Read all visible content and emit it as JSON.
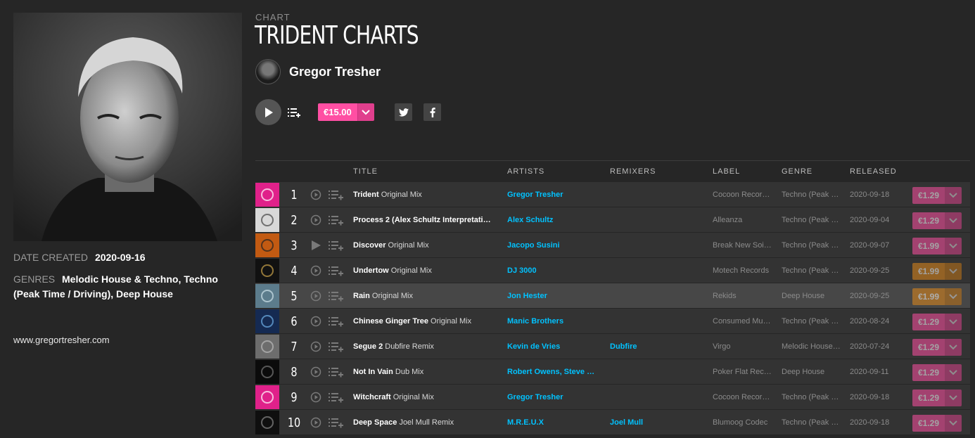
{
  "chart": {
    "eyebrow": "CHART",
    "title": "TRIDENT CHARTS",
    "curator": "Gregor Tresher",
    "price": "€15.00",
    "accent": "#ff4fa3",
    "link_color": "#01c2ff"
  },
  "sidebar": {
    "date_created_key": "DATE CREATED",
    "date_created": "2020-09-16",
    "genres_key": "GENRES",
    "genres": "Melodic House & Techno, Techno (Peak Time / Driving), Deep House",
    "website": "www.gregortresher.com"
  },
  "table": {
    "headers": {
      "title": "TITLE",
      "artists": "ARTISTS",
      "remixers": "REMIXERS",
      "label": "LABEL",
      "genre": "GENRE",
      "released": "RELEASED"
    },
    "rows": [
      {
        "num": "1",
        "title": "Trident",
        "mix": "Original Mix",
        "artists": "Gregor Tresher",
        "remixers": "",
        "label": "Cocoon Recor…",
        "genre": "Techno (Peak …",
        "released": "2020-09-18",
        "price": "€1.29",
        "price_color": "#ff4fa3"
      },
      {
        "num": "2",
        "title": "Process 2 (Alex Schultz Interpretati…",
        "mix": "",
        "artists": "Alex Schultz",
        "remixers": "",
        "label": "Alleanza",
        "genre": "Techno (Peak …",
        "released": "2020-09-04",
        "price": "€1.29",
        "price_color": "#ff4fa3"
      },
      {
        "num": "3",
        "title": "Discover",
        "mix": "Original Mix",
        "artists": "Jacopo Susini",
        "remixers": "",
        "label": "Break New Soi…",
        "genre": "Techno (Peak …",
        "released": "2020-09-07",
        "price": "€1.99",
        "price_color": "#ff4fa3"
      },
      {
        "num": "4",
        "title": "Undertow",
        "mix": "Original Mix",
        "artists": "DJ 3000",
        "remixers": "",
        "label": "Motech Records",
        "genre": "Techno (Peak …",
        "released": "2020-09-25",
        "price": "€1.99",
        "price_color": "#e38a1a"
      },
      {
        "num": "5",
        "title": "Rain",
        "mix": "Original Mix",
        "artists": "Jon Hester",
        "remixers": "",
        "label": "Rekids",
        "genre": "Deep House",
        "released": "2020-09-25",
        "price": "€1.99",
        "price_color": "#e38a1a"
      },
      {
        "num": "6",
        "title": "Chinese Ginger Tree",
        "mix": "Original Mix",
        "artists": "Manic Brothers",
        "remixers": "",
        "label": "Consumed Music",
        "genre": "Techno (Peak …",
        "released": "2020-08-24",
        "price": "€1.29",
        "price_color": "#ff4fa3"
      },
      {
        "num": "7",
        "title": "Segue 2",
        "mix": "Dubfire Remix",
        "artists": "Kevin de Vries",
        "remixers": "Dubfire",
        "label": "Virgo",
        "genre": "Melodic House…",
        "released": "2020-07-24",
        "price": "€1.29",
        "price_color": "#ff4fa3"
      },
      {
        "num": "8",
        "title": "Not In Vain",
        "mix": "Dub Mix",
        "artists": "Robert Owens, Steve B…",
        "remixers": "",
        "label": "Poker Flat Rec…",
        "genre": "Deep House",
        "released": "2020-09-11",
        "price": "€1.29",
        "price_color": "#ff4fa3"
      },
      {
        "num": "9",
        "title": "Witchcraft",
        "mix": "Original Mix",
        "artists": "Gregor Tresher",
        "remixers": "",
        "label": "Cocoon Recor…",
        "genre": "Techno (Peak …",
        "released": "2020-09-18",
        "price": "€1.29",
        "price_color": "#ff4fa3"
      },
      {
        "num": "10",
        "title": "Deep Space",
        "mix": "Joel Mull Remix",
        "artists": "M.R.E.U.X",
        "remixers": "Joel Mull",
        "label": "Blumoog Codec",
        "genre": "Techno (Peak …",
        "released": "2020-09-18",
        "price": "€1.29",
        "price_color": "#ff4fa3"
      }
    ]
  }
}
